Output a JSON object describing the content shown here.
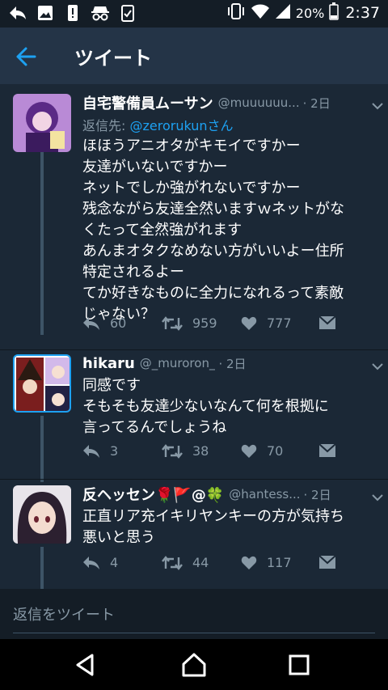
{
  "status_bar": {
    "battery": "20%",
    "time": "2:37",
    "left_icons": [
      "reply-arrow-icon",
      "image-icon",
      "alert-icon",
      "incognito-icon",
      "clipboard-check-icon"
    ],
    "right_icons": [
      "vibrate-icon",
      "wifi-icon",
      "signal-icon",
      "battery-icon"
    ]
  },
  "header": {
    "title": "ツイート"
  },
  "tweets": [
    {
      "name": "自宅警備員ムーサン",
      "handle": "@muuuuuu...",
      "time": "· 2日",
      "reply_prefix": "返信先: ",
      "reply_to": "@zerorukunさん",
      "lines": [
        "ほほうアニオタがキモイですかー",
        "友達がいないですかー",
        "ネットでしか強がれないですかー",
        "残念ながら友達全然いますｗネットがな",
        "くたって全然強がれます",
        "あんまオタクなめない方がいいよー住所",
        "特定されるよー",
        "てか好きなものに全力になれるって素敵",
        "じゃない？"
      ],
      "replies": "60",
      "retweets": "959",
      "likes": "777"
    },
    {
      "name": "hikaru",
      "handle": "@_muroron_",
      "time": "· 2日",
      "lines": [
        "同感です",
        "そもそも友達少ないなんて何を根拠に",
        "言ってるんでしょうね"
      ],
      "replies": "3",
      "retweets": "38",
      "likes": "70"
    },
    {
      "name": "反ヘッセン🌹🚩@🍀",
      "handle": "@hantess...",
      "time": "· 2日",
      "lines": [
        "正直リア充イキリヤンキーの方が気持ち",
        "悪いと思う"
      ],
      "replies": "4",
      "retweets": "44",
      "likes": "117"
    }
  ],
  "compose": {
    "placeholder": "返信をツイート"
  },
  "navbar": {
    "icons": [
      "back-triangle-icon",
      "home-circle-icon",
      "recents-square-icon"
    ]
  },
  "colors": {
    "background": "#1b2836",
    "header": "#243447",
    "accent": "#1da1f2",
    "secondary_text": "#8899a6"
  }
}
